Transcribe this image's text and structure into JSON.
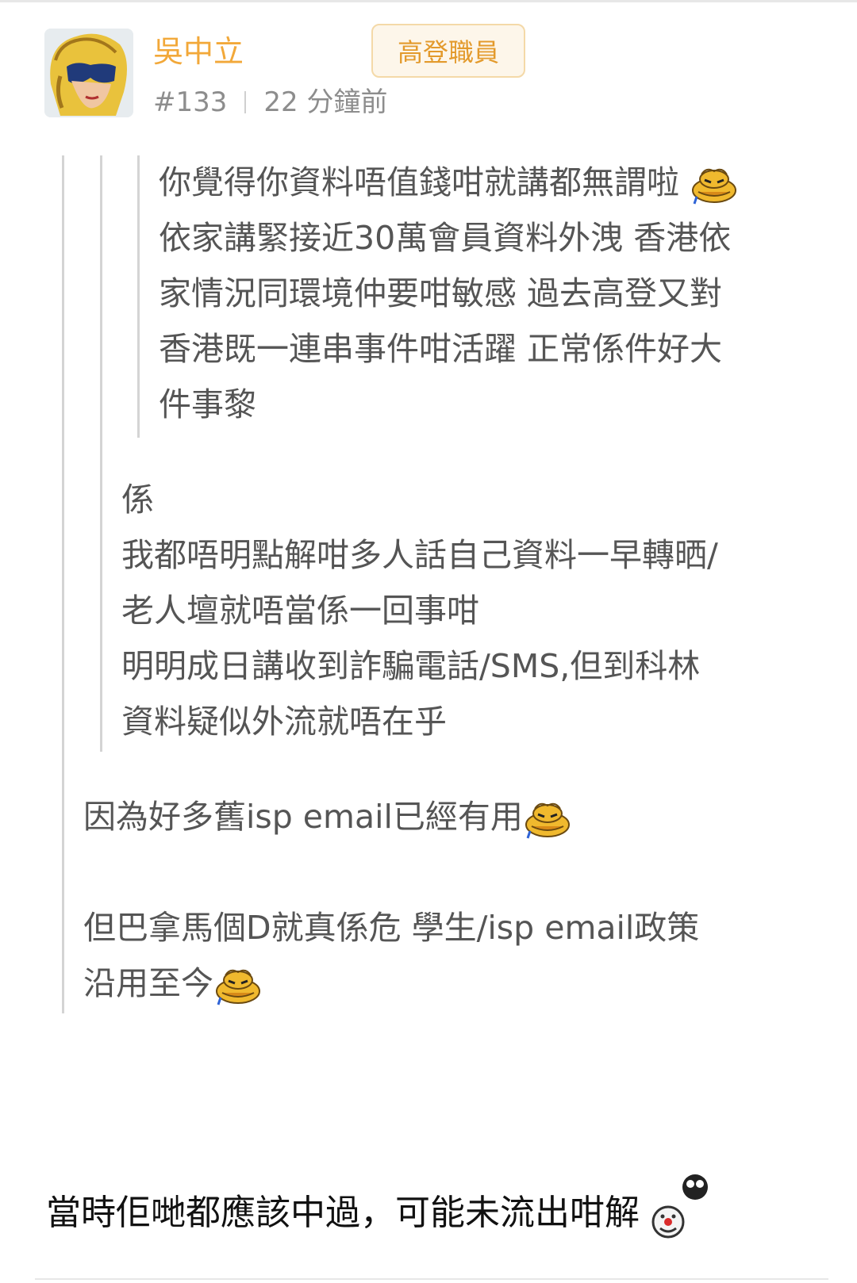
{
  "post": {
    "author": "吳中立",
    "badge": "高登職員",
    "post_number": "#133",
    "time": "22 分鐘前"
  },
  "quotes": {
    "level3_lines": [
      "你覺得你資料唔值錢咁就講都無謂啦",
      "依家講緊接近30萬會員資料外洩 香港依",
      "家情況同環境仲要咁敏感 過去高登又對",
      "香港既一連串事件咁活躍 正常係件好大",
      "件事黎"
    ],
    "level2_lines": [
      "係",
      "我都唔明點解咁多人話自己資料一早轉晒/",
      "老人壇就唔當係一回事咁",
      "明明成日講收到詐騙電話/SMS,但到科林",
      "資料疑似外流就唔在乎"
    ],
    "level1_line_a": "因為好多舊isp email已經有用",
    "level1_line_b1": "但巴拿馬個D就真係危 學生/isp email政策",
    "level1_line_b2": "沿用至今"
  },
  "reply": {
    "text": "當時佢哋都應該中過，可能未流出咁解"
  },
  "icons": {
    "emoji_1": "crying-bird-emoji-icon",
    "emoji_2": "clown-emoji-icon",
    "avatar": "sunglasses-avatar"
  },
  "colors": {
    "author": "#f2a839",
    "badge_text": "#e39a2c",
    "badge_border": "#f4d9a8",
    "badge_bg": "#fdf6ea",
    "meta": "#8d8d8d",
    "quote_text": "#555555",
    "quote_bar": "#d4d4d4",
    "reply_text": "#111111"
  }
}
